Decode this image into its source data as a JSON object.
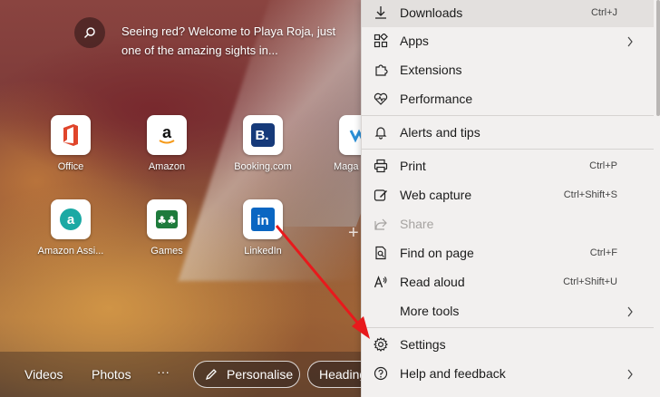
{
  "background": {
    "caption": "Seeing red? Welcome to Playa Roja, just one of the amazing sights in..."
  },
  "quick_links": [
    {
      "label": "Office"
    },
    {
      "label": "Amazon"
    },
    {
      "label": "Booking.com"
    },
    {
      "label": "Maga"
    },
    {
      "label": "Amazon Assi..."
    },
    {
      "label": "Games"
    },
    {
      "label": "LinkedIn"
    }
  ],
  "bottom_bar": {
    "videos": "Videos",
    "photos": "Photos",
    "more": "···",
    "personalise": "Personalise",
    "headings": "Heading"
  },
  "menu": {
    "items": [
      {
        "label": "Downloads",
        "shortcut": "Ctrl+J",
        "icon": "download-icon"
      },
      {
        "label": "Apps",
        "icon": "apps-icon"
      },
      {
        "label": "Extensions",
        "icon": "extensions-icon"
      },
      {
        "label": "Performance",
        "icon": "performance-icon"
      },
      {
        "label": "Alerts and tips",
        "icon": "bell-icon"
      },
      {
        "label": "Print",
        "shortcut": "Ctrl+P",
        "icon": "print-icon"
      },
      {
        "label": "Web capture",
        "shortcut": "Ctrl+Shift+S",
        "icon": "web-capture-icon"
      },
      {
        "label": "Share",
        "icon": "share-icon"
      },
      {
        "label": "Find on page",
        "shortcut": "Ctrl+F",
        "icon": "find-icon"
      },
      {
        "label": "Read aloud",
        "shortcut": "Ctrl+Shift+U",
        "icon": "read-aloud-icon"
      },
      {
        "label": "More tools",
        "icon": "more-tools-icon"
      },
      {
        "label": "Settings",
        "icon": "gear-icon"
      },
      {
        "label": "Help and feedback",
        "icon": "help-icon"
      }
    ]
  },
  "colors": {
    "annotation_arrow": "#e8191c",
    "menu_background": "#f2f0ef"
  }
}
